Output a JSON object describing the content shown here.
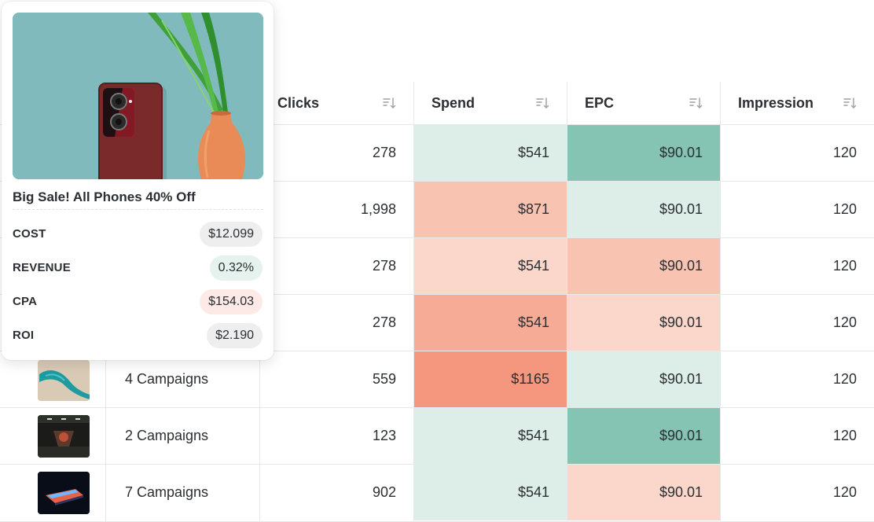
{
  "table": {
    "headers": [
      {
        "label": "Clicks"
      },
      {
        "label": "Spend"
      },
      {
        "label": "EPC"
      },
      {
        "label": "Impression"
      }
    ],
    "rows": [
      {
        "campaign": "",
        "clicks": "278",
        "spend": "$541",
        "epc": "$90.01",
        "impression": "120"
      },
      {
        "campaign": "",
        "clicks": "1,998",
        "spend": "$871",
        "epc": "$90.01",
        "impression": "120"
      },
      {
        "campaign": "",
        "clicks": "278",
        "spend": "$541",
        "epc": "$90.01",
        "impression": "120"
      },
      {
        "campaign": "",
        "clicks": "278",
        "spend": "$541",
        "epc": "$90.01",
        "impression": "120"
      },
      {
        "campaign": "4 Campaigns",
        "clicks": "559",
        "spend": "$1165",
        "epc": "$90.01",
        "impression": "120"
      },
      {
        "campaign": "2 Campaigns",
        "clicks": "123",
        "spend": "$541",
        "epc": "$90.01",
        "impression": "120"
      },
      {
        "campaign": "7 Campaigns",
        "clicks": "902",
        "spend": "$541",
        "epc": "$90.01",
        "impression": "120"
      }
    ],
    "spend_colors": [
      "#ddeee9",
      "#f8c3b1",
      "#fad6cb",
      "#f6ab97",
      "#f5967f",
      "#ddeee9",
      "#ddeee9"
    ],
    "epc_colors": [
      "#85c4b3",
      "#ddeee9",
      "#f8c3b1",
      "#fad6cb",
      "#ddeee9",
      "#85c4b3",
      "#fad6cb"
    ]
  },
  "popup": {
    "title": "Big Sale! All Phones 40% Off",
    "metrics": [
      {
        "label": "COST",
        "value": "$12.099",
        "color": "#eeeeee"
      },
      {
        "label": "REVENUE",
        "value": "0.32%",
        "color": "#e5f2ee"
      },
      {
        "label": "CPA",
        "value": "$154.03",
        "color": "#fdeae6"
      },
      {
        "label": "ROI",
        "value": "$2.190",
        "color": "#eeeeee"
      }
    ]
  },
  "icons": {
    "sort": "sort-icon",
    "product_image": "phone-product-image"
  }
}
